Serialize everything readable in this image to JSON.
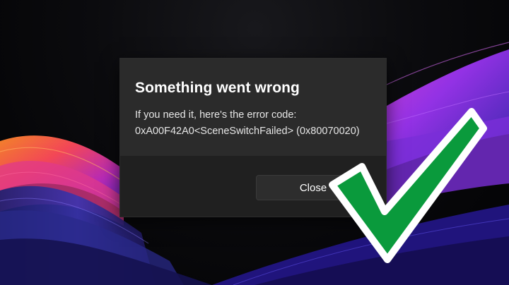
{
  "dialog": {
    "title": "Something went wrong",
    "message": "If you need it, here's the error code:",
    "error_code": "0xA00F42A0<SceneSwitchFailed> (0x80070020)",
    "close_label": "Close"
  },
  "overlay": {
    "icon": "checkmark-icon",
    "color": "#0a9a3c"
  },
  "wallpaper": {
    "colors": [
      "#ff7a1a",
      "#e8306a",
      "#b02cd8",
      "#7a3cff",
      "#2f2f9a"
    ]
  }
}
